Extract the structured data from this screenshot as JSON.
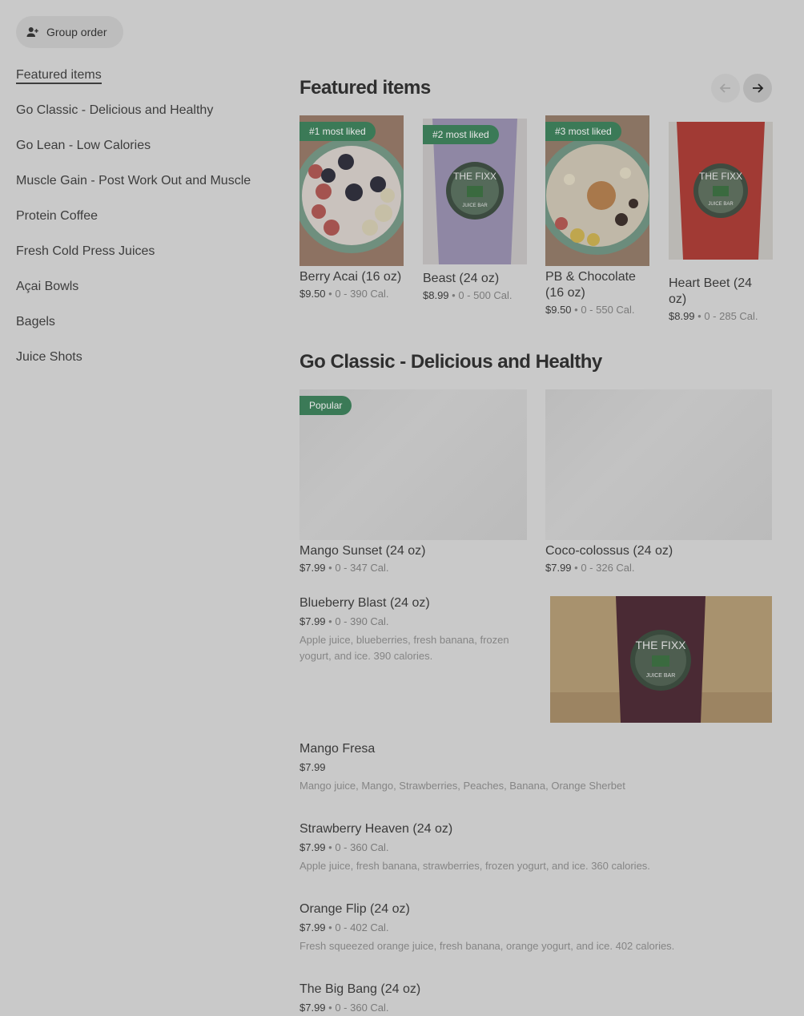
{
  "group_order": {
    "label": "Group order",
    "icon": "person-add-icon"
  },
  "sidebar": {
    "items": [
      {
        "label": "Featured items",
        "active": true
      },
      {
        "label": "Go Classic - Delicious and Healthy"
      },
      {
        "label": "Go Lean - Low Calories"
      },
      {
        "label": "Muscle Gain - Post Work Out and Muscle"
      },
      {
        "label": "Protein Coffee"
      },
      {
        "label": "Fresh Cold Press Juices"
      },
      {
        "label": "Açai Bowls"
      },
      {
        "label": "Bagels"
      },
      {
        "label": "Juice Shots"
      }
    ]
  },
  "featured": {
    "title": "Featured items",
    "cards": [
      {
        "badge": "#1 most liked",
        "name": " Berry Acai  (16 oz)",
        "price": "$9.50",
        "cal": "0 - 390 Cal.",
        "image": "acai-bowl"
      },
      {
        "badge": "#2 most liked",
        "name": "Beast (24 oz)",
        "price": "$8.99",
        "cal": "0 - 500 Cal.",
        "image": "purple-smoothie"
      },
      {
        "badge": "#3 most liked",
        "name": "PB & Chocolate (16 oz)",
        "price": "$9.50",
        "cal": "0 - 550 Cal.",
        "image": "pb-bowl"
      },
      {
        "badge": "",
        "name": "Heart Beet (24 oz)",
        "price": "$8.99",
        "cal": "0 - 285 Cal.",
        "image": "red-smoothie"
      }
    ]
  },
  "classic": {
    "title": "Go Classic - Delicious and Healthy",
    "grid": [
      {
        "badge": "Popular",
        "name": "Mango Sunset (24 oz)",
        "price": "$7.99",
        "cal": "0 - 347 Cal."
      },
      {
        "badge": "",
        "name": "Coco-colossus (24 oz)",
        "price": "$7.99",
        "cal": "0 - 326 Cal."
      }
    ],
    "list": [
      {
        "name": "Blueberry Blast (24 oz)",
        "price": "$7.99",
        "cal": "0 - 390 Cal.",
        "desc": "Apple juice, blueberries, fresh banana, frozen yogurt, and ice. 390 calories."
      },
      {
        "name": "Mango Fresa",
        "price": "$7.99",
        "cal": "",
        "desc": "Mango juice, Mango, Strawberries, Peaches, Banana, Orange Sherbet"
      },
      {
        "name": "Strawberry Heaven (24 oz)",
        "price": "$7.99",
        "cal": "0 - 360 Cal.",
        "desc": "Apple juice, fresh banana, strawberries, frozen yogurt, and ice. 360 calories."
      },
      {
        "name": "Orange Flip (24 oz)",
        "price": "$7.99",
        "cal": "0 - 402 Cal.",
        "desc": "Fresh squeezed orange juice, fresh banana, orange yogurt, and ice. 402 calories."
      },
      {
        "name": "The Big Bang (24 oz)",
        "price": "$7.99",
        "cal": "0 - 360 Cal.",
        "desc": ""
      }
    ]
  },
  "cup_logo": {
    "text": "THE FIXX",
    "sub": "JUICE BAR"
  },
  "colors": {
    "background": "#c9c9c9",
    "badge": "#3b7a57",
    "text": "#3a3a3a",
    "muted": "#7a7a7a"
  }
}
